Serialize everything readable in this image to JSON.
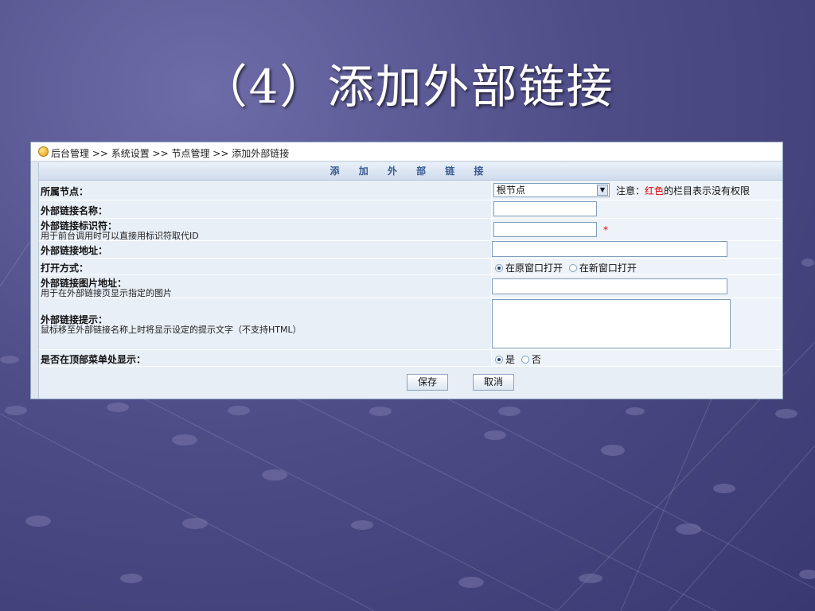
{
  "slide": {
    "title": "（4）添加外部链接"
  },
  "breadcrumb": {
    "text": "后台管理 >> 系统设置 >> 节点管理 >> 添加外部链接"
  },
  "form": {
    "heading": "添 加 外 部 链 接",
    "parent_node": {
      "label": "所属节点：",
      "selected": "根节点",
      "note_prefix": "注意：",
      "note_red": "红色",
      "note_suffix": "的栏目表示没有权限"
    },
    "link_name": {
      "label": "外部链接名称：",
      "value": ""
    },
    "link_id": {
      "label": "外部链接标识符：",
      "hint": "用于前台调用时可以直接用标识符取代ID",
      "value": "",
      "required_mark": "*"
    },
    "link_url": {
      "label": "外部链接地址：",
      "value": ""
    },
    "open_mode": {
      "label": "打开方式：",
      "options": [
        "在原窗口打开",
        "在新窗口打开"
      ],
      "selected_index": 0
    },
    "image_url": {
      "label": "外部链接图片地址：",
      "hint": "用于在外部链接页显示指定的图片",
      "value": ""
    },
    "tooltip": {
      "label": "外部链接提示：",
      "hint": "鼠标移至外部链接名称上时将显示设定的提示文字（不支持HTML）",
      "value": ""
    },
    "show_in_top_menu": {
      "label": "是否在顶部菜单处显示：",
      "options": [
        "是",
        "否"
      ],
      "selected_index": 0
    },
    "buttons": {
      "save": "保存",
      "cancel": "取消"
    }
  },
  "colors": {
    "slide_bg": "#4f4d88",
    "panel_bg": "#e8eef6",
    "heading_text": "#3a5a92",
    "warning_red": "#e00000"
  },
  "icons": {
    "breadcrumb": "home-globe-icon"
  }
}
